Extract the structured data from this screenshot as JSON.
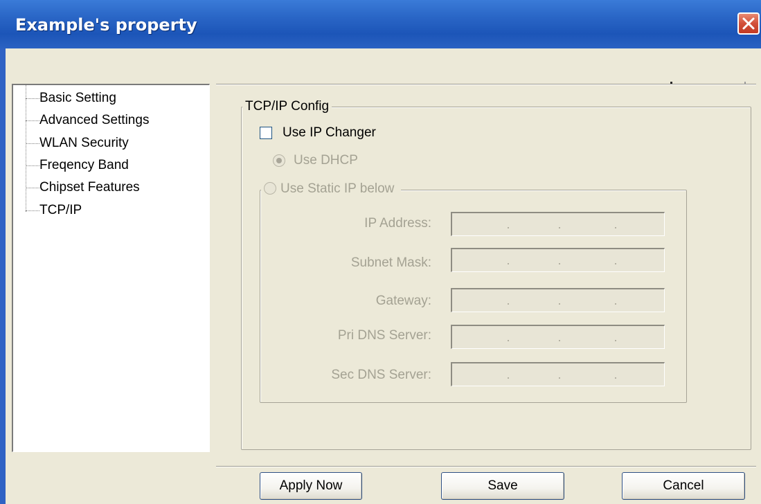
{
  "window": {
    "title": "Example's property",
    "close_icon": "close-icon"
  },
  "tree": {
    "items": [
      {
        "label": "Basic Setting"
      },
      {
        "label": "Advanced Settings"
      },
      {
        "label": "WLAN Security"
      },
      {
        "label": "Freqency Band"
      },
      {
        "label": "Chipset Features"
      },
      {
        "label": "TCP/IP"
      }
    ]
  },
  "tcpip": {
    "group_title": "TCP/IP Config",
    "use_ip_changer_label": "Use IP Changer",
    "use_ip_changer_checked": false,
    "use_dhcp_label": "Use DHCP",
    "use_dhcp_selected": true,
    "use_static_label": "Use Static IP below",
    "use_static_selected": false,
    "fields": [
      {
        "label": "IP Address:",
        "value": ""
      },
      {
        "label": "Subnet Mask:",
        "value": ""
      },
      {
        "label": "Gateway:",
        "value": ""
      },
      {
        "label": "Pri DNS Server:",
        "value": ""
      },
      {
        "label": "Sec DNS Server:",
        "value": ""
      }
    ]
  },
  "buttons": {
    "apply_label": "Apply Now",
    "save_label": "Save",
    "cancel_label": "Cancel"
  },
  "colors": {
    "titlebar": "#2A66C6",
    "window_bg": "#ECE9D8",
    "disabled_text": "#A4A293",
    "close_button": "#D2503A"
  }
}
